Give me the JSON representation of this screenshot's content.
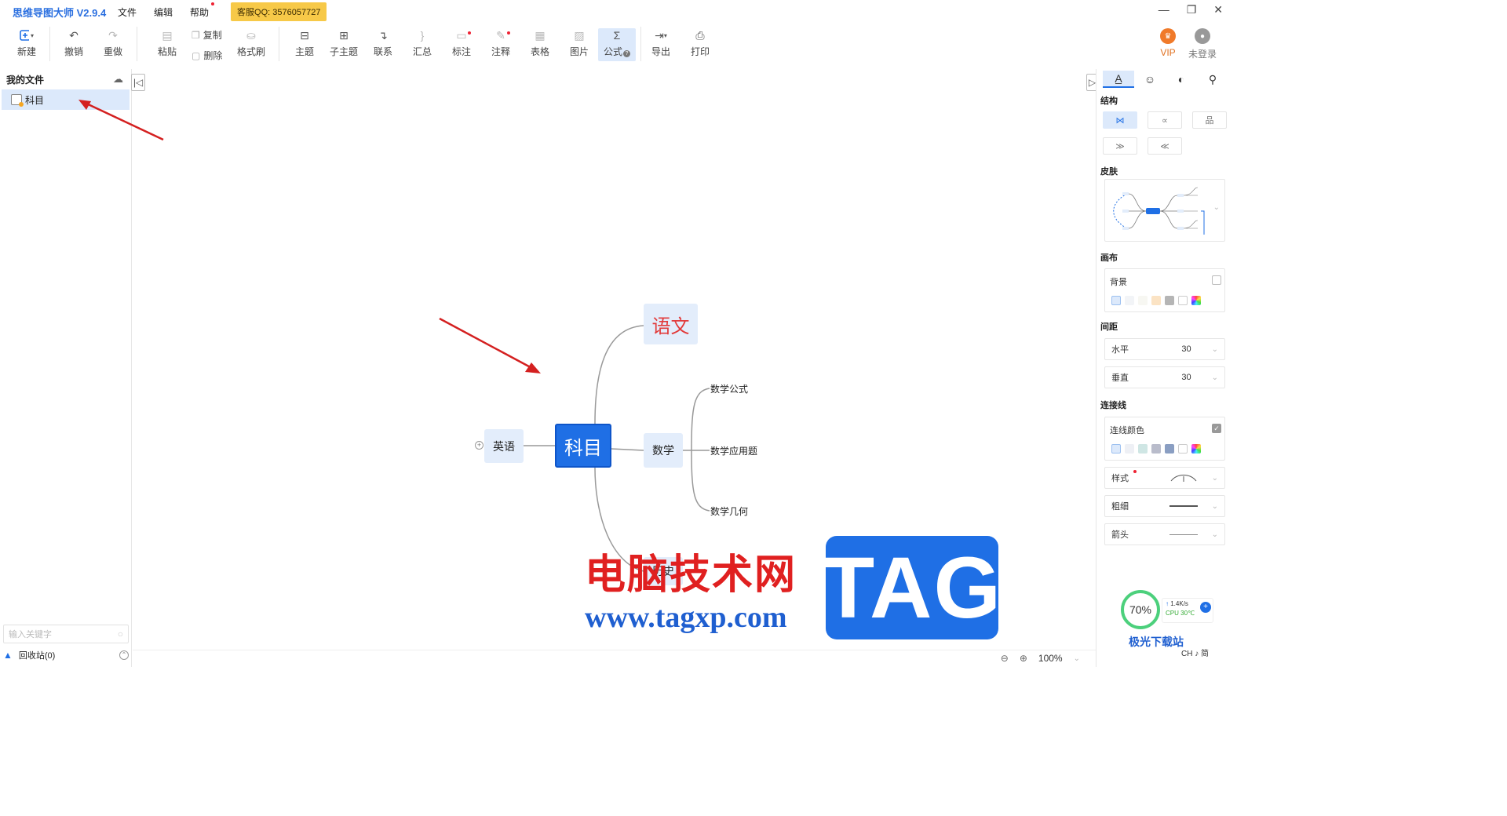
{
  "app": {
    "title": "思维导图大师 V2.9.4"
  },
  "menu": {
    "file": "文件",
    "edit": "编辑",
    "help": "帮助",
    "qq": "客服QQ: 3576057727"
  },
  "window_controls": {
    "minimize": "—",
    "restore": "❐",
    "close": "✕"
  },
  "toolbar": {
    "new": "新建",
    "undo": "撤销",
    "redo": "重做",
    "paste": "粘贴",
    "copy": "复制",
    "delete": "删除",
    "format_brush": "格式刷",
    "topic": "主题",
    "subtopic": "子主题",
    "relation": "联系",
    "summary": "汇总",
    "marker": "标注",
    "note": "注释",
    "table": "表格",
    "image": "图片",
    "formula": "公式",
    "export": "导出",
    "print": "打印",
    "vip": "VIP",
    "login": "未登录"
  },
  "left_panel": {
    "title": "我的文件",
    "files": [
      {
        "name": "科目"
      }
    ],
    "search_placeholder": "输入关键字",
    "recycle": "回收站(0)"
  },
  "mindmap": {
    "root": "科目",
    "left_children": [
      {
        "label": "英语"
      }
    ],
    "right_children": [
      {
        "label": "语文",
        "color": "#e23b3b"
      },
      {
        "label": "数学",
        "children": [
          "数学公式",
          "数学应用题",
          "数学几何"
        ]
      },
      {
        "label": "历史"
      }
    ]
  },
  "statusbar": {
    "zoom": "100%"
  },
  "right_panel": {
    "sections": {
      "structure": "结构",
      "skin": "皮肤",
      "canvas": "画布",
      "spacing": "间距",
      "connector": "连接线"
    },
    "background": "背景",
    "horizontal": {
      "label": "水平",
      "value": "30"
    },
    "vertical": {
      "label": "垂直",
      "value": "30"
    },
    "line_color": "连线颜色",
    "style": "样式",
    "thickness": "粗细",
    "arrow": "箭头"
  },
  "watermark": {
    "cn": "电脑技术网",
    "url": "www.tagxp.com",
    "tag": "TAG",
    "site2": "极光下载站",
    "site2_sub": "CH ♪ 简"
  },
  "perf": {
    "percent": "70%",
    "speed": "1.4K/s",
    "cpu": "CPU 30℃"
  },
  "colors": {
    "accent": "#1f6fe5",
    "root_fill": "#1f6fe5",
    "sub_fill": "#e3edfb",
    "arrow": "#d42020"
  }
}
